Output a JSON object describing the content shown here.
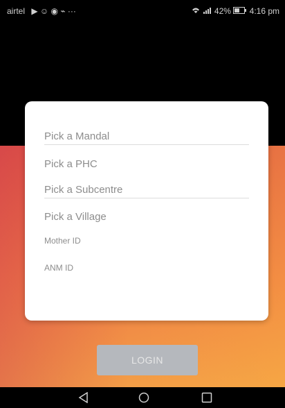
{
  "status_bar": {
    "carrier": "airtel",
    "notification_icons": "▶ ☺ ◉ ⌁ ···",
    "wifi_icon": "wifi-icon",
    "signal_icon": "signal-icon",
    "battery_text": "42%",
    "time": "4:16 pm"
  },
  "form": {
    "fields": [
      {
        "label": "Pick a Mandal"
      },
      {
        "label": "Pick a PHC"
      },
      {
        "label": "Pick a Subcentre"
      },
      {
        "label": "Pick a Village"
      },
      {
        "label": "Mother ID"
      },
      {
        "label": "ANM ID"
      }
    ]
  },
  "login_button": {
    "label": "LOGIN"
  },
  "nav_bar": {
    "back_icon": "back-triangle-icon",
    "home_icon": "home-circle-icon",
    "recents_icon": "recents-square-icon"
  },
  "colors": {
    "gradient_top": "#e05a45",
    "gradient_bottom": "#f39e47",
    "card": "#ffffff",
    "button": "#b5b8bd"
  }
}
